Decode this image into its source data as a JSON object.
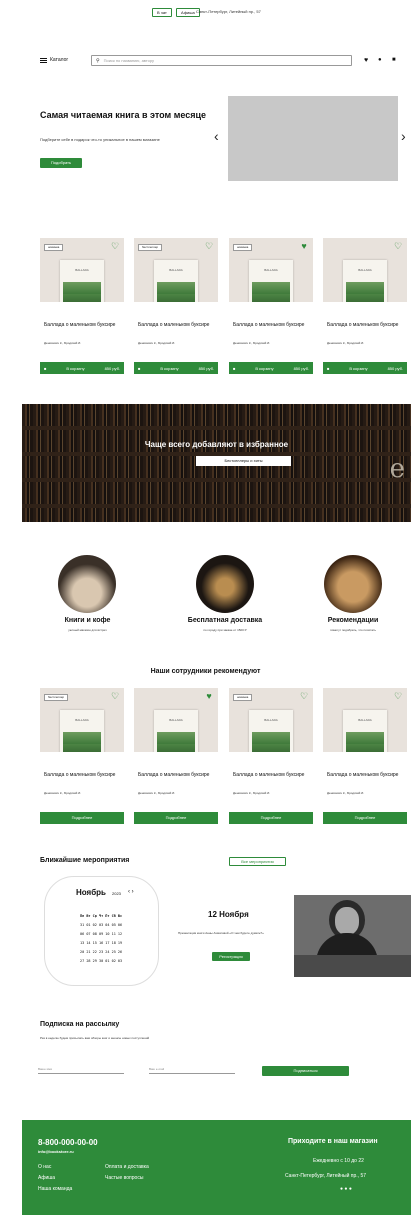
{
  "topbar": {
    "pill1": "В чат",
    "pill2": "Афиша",
    "address": "Санкт-Петербург, Литейный пр., 57"
  },
  "header": {
    "catalog": "Каталог",
    "search_placeholder": "Поиск по названию, автору",
    "icons": [
      "heart-icon",
      "user-icon",
      "cart-icon"
    ]
  },
  "hero": {
    "title": "Самая читаемая книга в этом месяце",
    "subtitle": "Подберите себе в подарок что-то уникальное в нашем магазине",
    "button": "Подобрать",
    "prev": "‹",
    "next": "›"
  },
  "products": [
    {
      "tag": "новинка",
      "title": "Баллада о маленьком буксире",
      "author": "Денисевич К., Бродский И.",
      "buy": "В корзину",
      "price": "850 руб.",
      "liked": false
    },
    {
      "tag": "бестселлер",
      "title": "Баллада о маленьком буксире",
      "author": "Денисевич К., Бродский И.",
      "buy": "В корзину",
      "price": "850 руб.",
      "liked": false
    },
    {
      "tag": "новинка",
      "title": "Баллада о маленьком буксире",
      "author": "Денисевич К., Бродский И.",
      "buy": "В корзину",
      "price": "850 руб.",
      "liked": true
    },
    {
      "tag": "",
      "title": "Баллада о маленьком буксире",
      "author": "Денисевич К., Бродский И.",
      "buy": "В корзину",
      "price": "850 руб.",
      "liked": false
    }
  ],
  "book_cover_text": "BALLADA",
  "banner": {
    "title": "Чаще всего добавляют в избранное",
    "button": "Бестселлеры и хиты",
    "letter": "e"
  },
  "features": [
    {
      "title": "Книги и кофе",
      "sub": "уютный магазин для встреч"
    },
    {
      "title": "Бесплатная доставка",
      "sub": "по городу при заказе от 1500 Р"
    },
    {
      "title": "Рекомендации",
      "sub": "помогут подобрать, что почитать"
    }
  ],
  "staff_title": "Наши сотрудники рекомендуют",
  "staff_products": [
    {
      "tag": "бестселлер",
      "title": "Баллада о маленьком буксире",
      "author": "Денисевич К., Бродский И.",
      "more": "Подробнее",
      "liked": false
    },
    {
      "tag": "",
      "title": "Баллада о маленьком буксире",
      "author": "Денисевич К., Бродский И.",
      "more": "Подробнее",
      "liked": true
    },
    {
      "tag": "новинка",
      "title": "Баллада о маленьком буксире",
      "author": "Денисевич К., Бродский И.",
      "more": "Подробнее",
      "liked": false
    },
    {
      "tag": "",
      "title": "Баллада о маленьком буксире",
      "author": "Денисевич К., Бродский И.",
      "more": "Подробнее",
      "liked": false
    }
  ],
  "events": {
    "title": "Ближайшие мероприятия",
    "all_button": "Все мероприятия",
    "month": "Ноябрь",
    "year": "2023",
    "nav": "‹ ›",
    "weekdays": "Пн Вт Ср Чт Пт Сб Вс",
    "weeks": [
      "31 01 02 03 04 05 06",
      "06 07 08 09 10 11 12",
      "13 14 15 16 17 18 19",
      "20 21 22 23 24 25 26",
      "27 28 29 30 01 02 03"
    ],
    "date": "12 Ноября",
    "desc": "Презентация книги Анны Ахматовой «О чем будете думать?»",
    "register": "Регистрация"
  },
  "subscribe": {
    "title": "Подписка на рассылку",
    "sub": "Раз в неделю будем присылать вам обзоры книг и анонсы новых поступлений",
    "name_placeholder": "Ваше имя",
    "email_placeholder": "Ваш e-mail",
    "button": "Подписаться"
  },
  "footer": {
    "phone": "8-800-000-00-00",
    "email": "info@bookstore.ru",
    "links_col1": [
      "О нас",
      "Афиша",
      "Наша команда"
    ],
    "links_col2": [
      "Оплата и доставка",
      "Частые вопросы"
    ],
    "visit_title": "Приходите в наш магазин",
    "hours": "Ежедневно с 10 до 22",
    "address": "Санкт-Петербург, Литейный пр., 57",
    "dots": "● ● ●"
  },
  "colors": {
    "accent": "#2e8b3a"
  }
}
